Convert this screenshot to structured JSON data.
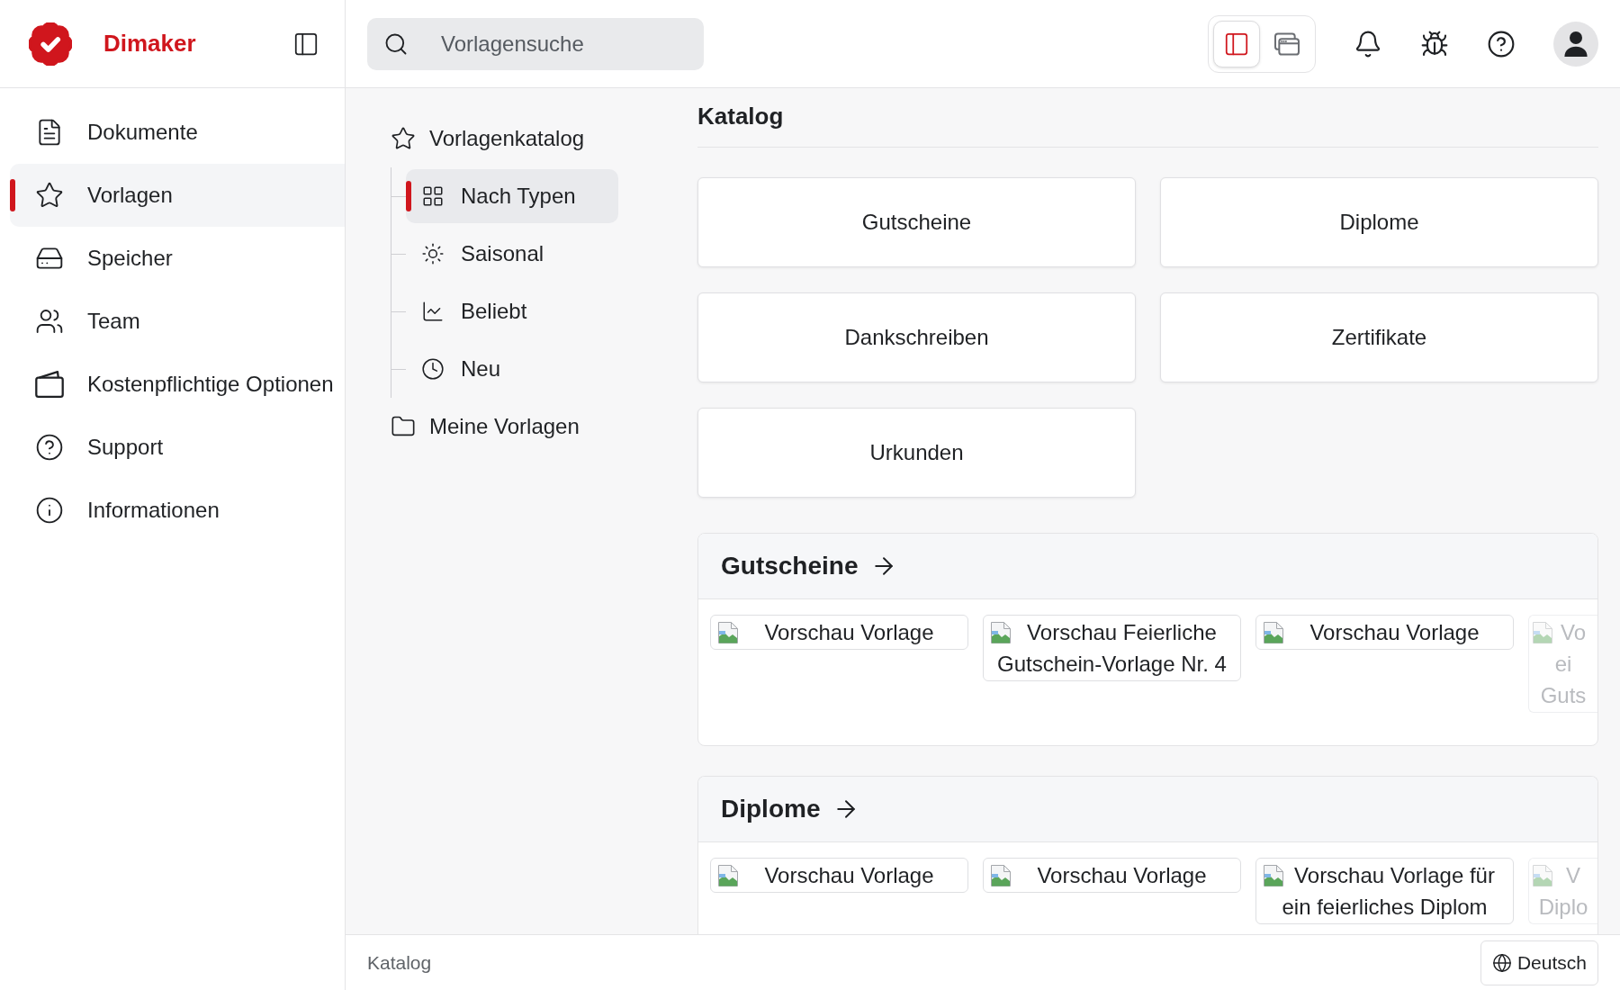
{
  "header": {
    "brand": "Dimaker",
    "search": {
      "placeholder": "Vorlagensuche"
    },
    "view_modes": [
      {
        "kind": "sidebar",
        "selected": true
      },
      {
        "kind": "windows",
        "selected": false
      }
    ]
  },
  "sidebar": {
    "items": [
      {
        "label": "Dokumente",
        "selected": false
      },
      {
        "label": "Vorlagen",
        "selected": true
      },
      {
        "label": "Speicher",
        "selected": false
      },
      {
        "label": "Team",
        "selected": false
      },
      {
        "label": "Kostenpflichtige Optionen",
        "selected": false
      },
      {
        "label": "Support",
        "selected": false
      },
      {
        "label": "Informationen",
        "selected": false
      }
    ]
  },
  "tree": [
    {
      "label": "Vorlagenkatalog",
      "selected": false,
      "children": [
        {
          "label": "Nach Typen",
          "selected": true
        },
        {
          "label": "Saisonal",
          "selected": false
        },
        {
          "label": "Beliebt",
          "selected": false
        },
        {
          "label": "Neu",
          "selected": false
        }
      ]
    },
    {
      "label": "Meine Vorlagen",
      "selected": false
    }
  ],
  "catalog": {
    "title": "Katalog",
    "categories": [
      "Gutscheine",
      "Diplome",
      "Dankschreiben",
      "Zertifikate",
      "Urkunden"
    ],
    "sections": [
      {
        "title": "Gutscheine",
        "previews": [
          {
            "kind": "full",
            "text": "Vorschau Vorlage"
          },
          {
            "kind": "full",
            "text": "Vorschau Feierliche Gutschein-Vorlage Nr. 4"
          },
          {
            "kind": "full",
            "text": "Vorschau Vorlage"
          },
          {
            "kind": "partial",
            "lines": [
              "Vo",
              "ei",
              "Guts"
            ]
          }
        ]
      },
      {
        "title": "Diplome",
        "previews": [
          {
            "kind": "full",
            "text": "Vorschau Vorlage"
          },
          {
            "kind": "full",
            "text": "Vorschau Vorlage"
          },
          {
            "kind": "full",
            "text": "Vorschau Vorlage für ein feierliches Diplom"
          },
          {
            "kind": "partial",
            "lines": [
              "V",
              "Diplo"
            ]
          }
        ]
      }
    ]
  },
  "footer": {
    "breadcrumb": "Katalog",
    "language": "Deutsch"
  }
}
